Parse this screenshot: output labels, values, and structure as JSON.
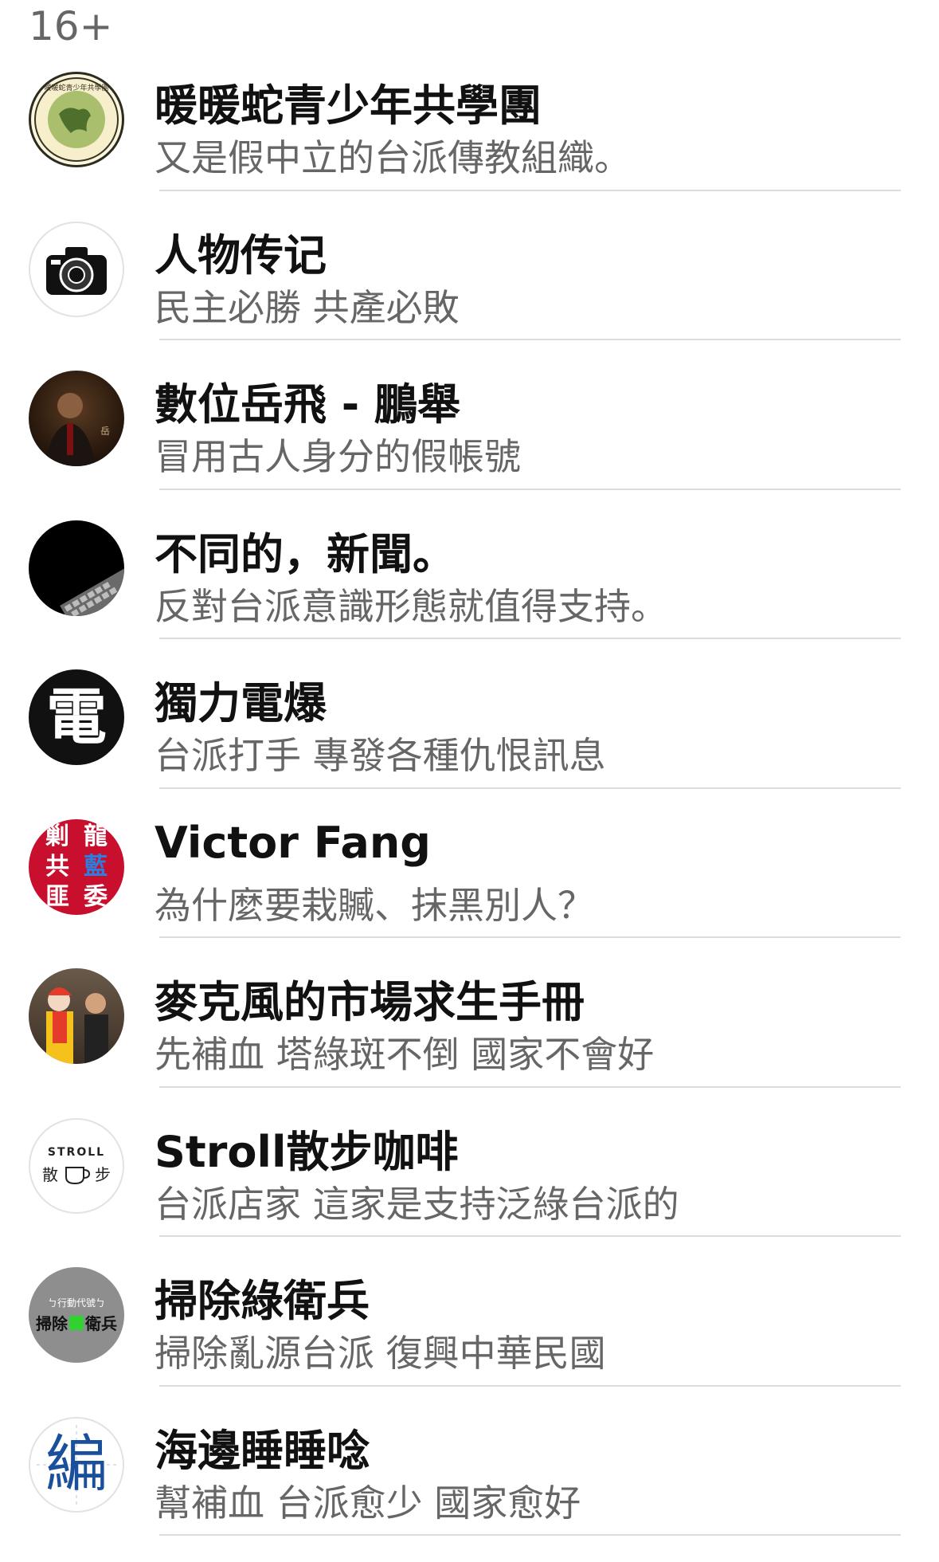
{
  "header": {
    "count": "16+"
  },
  "items": [
    {
      "name": "暖暖蛇青少年共學團",
      "desc": "又是假中立的台派傳教組織。",
      "avatar": "map-logo-icon"
    },
    {
      "name": "人物传记",
      "desc": "民主必勝 共產必敗",
      "avatar": "camera-icon"
    },
    {
      "name": "數位岳飛 - 鵬舉",
      "desc": "冒用古人身分的假帳號",
      "avatar": "portrait-photo"
    },
    {
      "name": "不同的，新聞。",
      "desc": "反對台派意識形態就值得支持。",
      "avatar": "keyboard-photo"
    },
    {
      "name": "獨力電爆",
      "desc": "台派打手 專發各種仇恨訊息",
      "avatar": "lightning-character-logo",
      "avatar_char": "電"
    },
    {
      "name": "Victor Fang",
      "desc": "為什麼要栽贓、抹黑別人？",
      "avatar": "red-character-grid",
      "avatar_chars": [
        "剿",
        "龍",
        "共",
        "藍",
        "匪",
        "委"
      ]
    },
    {
      "name": "麥克風的市場求生手冊",
      "desc": "先補血 塔綠斑不倒 國家不會好",
      "avatar": "clown-photo"
    },
    {
      "name": "Stroll散步咖啡",
      "desc": "台派店家 這家是支持泛綠台派的",
      "avatar": "coffee-cup-logo",
      "avatar_text": "STROLL",
      "avatar_chars": [
        "散",
        "步"
      ]
    },
    {
      "name": "掃除綠衛兵",
      "desc": "掃除亂源台派 復興中華民國",
      "avatar": "gray-text-logo",
      "avatar_line1": "ㄅ行動代號ㄅ",
      "avatar_line2_a": "掃除",
      "avatar_line2_b": "衛兵"
    },
    {
      "name": "海邊睡睡唸",
      "desc": "幫補血 台派愈少 國家愈好",
      "avatar": "blue-character-logo",
      "avatar_char": "編"
    }
  ],
  "colors": {
    "title": "#111111",
    "subtitle": "#666666",
    "divider": "#dcdcdc",
    "red_logo": "#c8102e",
    "blue_logo": "#1a4f9c",
    "green_mark": "#2fd22f"
  }
}
